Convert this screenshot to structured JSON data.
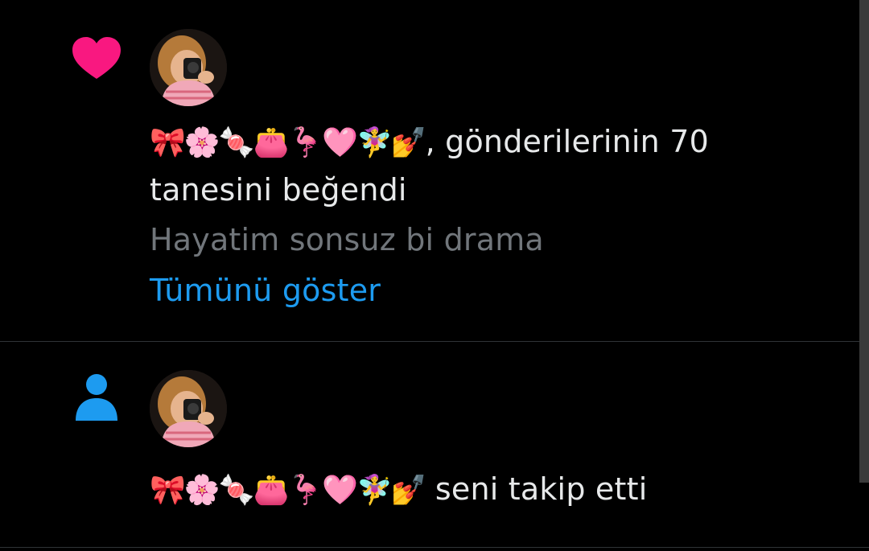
{
  "colors": {
    "background": "#000000",
    "text_primary": "#e7e9ea",
    "text_secondary": "#71767b",
    "accent_blue": "#1d9bf0",
    "like_pink": "#f91880",
    "divider": "#2f3336"
  },
  "notifications": [
    {
      "type": "like",
      "icon": "heart-icon",
      "user_display_name": "🎀🌸🍬👛🦩🩷🧚‍♀️💅",
      "action_text_line1": ", gönderilerinin 70",
      "action_text_line2": "tanesini beğendi",
      "preview_text": "Hayatim sonsuz bi drama",
      "show_all_label": "Tümünü göster"
    },
    {
      "type": "follow",
      "icon": "person-icon",
      "user_display_name": "🎀🌸🍬👛🦩🩷🧚‍♀️💅",
      "action_text": " seni takip etti"
    }
  ]
}
